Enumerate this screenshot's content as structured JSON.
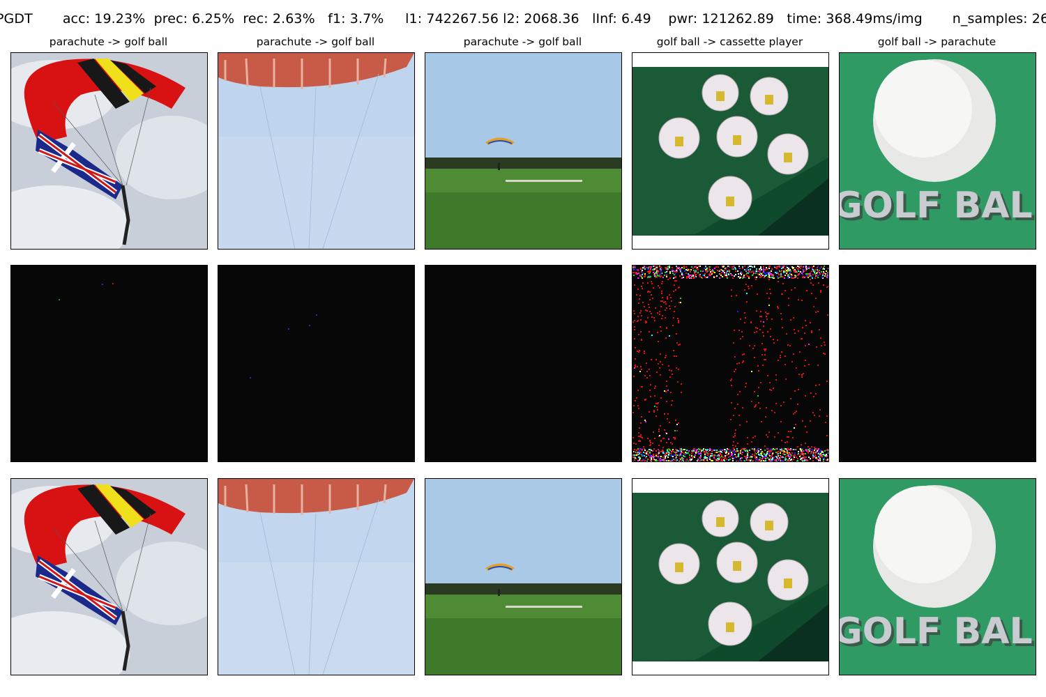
{
  "header": {
    "method": "PGDT",
    "acc": "acc: 19.23%",
    "prec": "prec: 6.25%",
    "rec": "rec: 2.63%",
    "f1": "f1: 3.7%",
    "l1": "l1: 742267.56",
    "l2": "l2: 2068.36",
    "linf": "lInf: 6.49",
    "pwr": "pwr: 121262.89",
    "time": "time: 368.49ms/img",
    "n_samples": "n_samples: 26"
  },
  "columns": [
    {
      "title": "parachute -> golf ball"
    },
    {
      "title": "parachute -> golf ball"
    },
    {
      "title": "parachute -> golf ball"
    },
    {
      "title": "golf ball -> cassette player"
    },
    {
      "title": "golf ball -> parachute"
    }
  ],
  "image_text": {
    "golf_ball_sign": "GOLF BAL"
  },
  "colors": {
    "sky": "#c6d6e6",
    "pale_sky": "#b9d2ee",
    "grass": "#4f8a35",
    "felt_dark": "#0f4a2c",
    "felt_green": "#2f9a64",
    "canopy_red": "#e01010",
    "canopy_yellow": "#f2e21a",
    "perturbation_bg": "#070707"
  }
}
